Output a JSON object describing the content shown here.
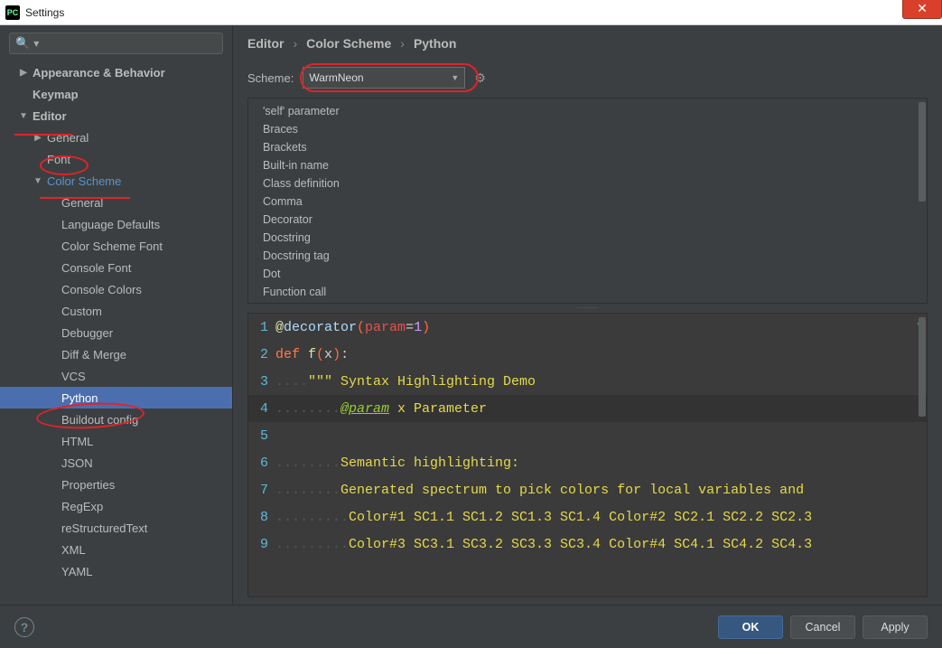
{
  "window": {
    "title": "Settings"
  },
  "search": {
    "placeholder": "Q"
  },
  "sidebar": {
    "items": [
      {
        "label": "Appearance & Behavior",
        "bold": true,
        "caret": "right",
        "cls": ""
      },
      {
        "label": "Keymap",
        "bold": true,
        "caret": "",
        "cls": "nocaret"
      },
      {
        "label": "Editor",
        "bold": true,
        "caret": "down",
        "cls": ""
      },
      {
        "label": "General",
        "bold": false,
        "caret": "right",
        "cls": "ind1"
      },
      {
        "label": "Font",
        "bold": false,
        "caret": "",
        "cls": "ind1 nocaret"
      },
      {
        "label": "Color Scheme",
        "bold": false,
        "caret": "down",
        "cls": "ind1 active"
      },
      {
        "label": "General",
        "bold": false,
        "caret": "",
        "cls": "ind2 nocaret"
      },
      {
        "label": "Language Defaults",
        "bold": false,
        "caret": "",
        "cls": "ind2 nocaret"
      },
      {
        "label": "Color Scheme Font",
        "bold": false,
        "caret": "",
        "cls": "ind2 nocaret"
      },
      {
        "label": "Console Font",
        "bold": false,
        "caret": "",
        "cls": "ind2 nocaret"
      },
      {
        "label": "Console Colors",
        "bold": false,
        "caret": "",
        "cls": "ind2 nocaret"
      },
      {
        "label": "Custom",
        "bold": false,
        "caret": "",
        "cls": "ind2 nocaret"
      },
      {
        "label": "Debugger",
        "bold": false,
        "caret": "",
        "cls": "ind2 nocaret"
      },
      {
        "label": "Diff & Merge",
        "bold": false,
        "caret": "",
        "cls": "ind2 nocaret"
      },
      {
        "label": "VCS",
        "bold": false,
        "caret": "",
        "cls": "ind2 nocaret"
      },
      {
        "label": "Python",
        "bold": false,
        "caret": "",
        "cls": "ind2 nocaret selected"
      },
      {
        "label": "Buildout config",
        "bold": false,
        "caret": "",
        "cls": "ind2 nocaret"
      },
      {
        "label": "HTML",
        "bold": false,
        "caret": "",
        "cls": "ind2 nocaret"
      },
      {
        "label": "JSON",
        "bold": false,
        "caret": "",
        "cls": "ind2 nocaret"
      },
      {
        "label": "Properties",
        "bold": false,
        "caret": "",
        "cls": "ind2 nocaret"
      },
      {
        "label": "RegExp",
        "bold": false,
        "caret": "",
        "cls": "ind2 nocaret"
      },
      {
        "label": "reStructuredText",
        "bold": false,
        "caret": "",
        "cls": "ind2 nocaret"
      },
      {
        "label": "XML",
        "bold": false,
        "caret": "",
        "cls": "ind2 nocaret"
      },
      {
        "label": "YAML",
        "bold": false,
        "caret": "",
        "cls": "ind2 nocaret"
      }
    ]
  },
  "breadcrumb": {
    "a": "Editor",
    "b": "Color Scheme",
    "c": "Python"
  },
  "scheme": {
    "label": "Scheme:",
    "value": "WarmNeon"
  },
  "attrs": [
    "'self' parameter",
    "Braces",
    "Brackets",
    "Built-in name",
    "Class definition",
    "Comma",
    "Decorator",
    "Docstring",
    "Docstring tag",
    "Dot",
    "Function call"
  ],
  "code": {
    "lines": [
      {
        "n": "1",
        "seg": [
          [
            "tk-at",
            "@"
          ],
          [
            "tk-dec",
            "decorator"
          ],
          [
            "tk-paren",
            "("
          ],
          [
            "tk-param",
            "param"
          ],
          [
            "tk-default",
            "="
          ],
          [
            "tk-num",
            "1"
          ],
          [
            "tk-paren",
            ")"
          ]
        ]
      },
      {
        "n": "2",
        "seg": [
          [
            "tk-kw",
            "def "
          ],
          [
            "tk-fn",
            "f"
          ],
          [
            "tk-paren",
            "("
          ],
          [
            "tk-default",
            "x"
          ],
          [
            "tk-paren",
            ")"
          ],
          [
            "tk-default",
            ":"
          ]
        ]
      },
      {
        "n": "3",
        "seg": [
          [
            "tk-dots",
            "...."
          ],
          [
            "tk-str",
            "\"\"\" Syntax Highlighting Demo"
          ]
        ]
      },
      {
        "n": "4",
        "hl": true,
        "seg": [
          [
            "tk-dots",
            "........"
          ],
          [
            "tk-doctag",
            "@param"
          ],
          [
            "tk-str",
            " x Parameter"
          ]
        ]
      },
      {
        "n": "5",
        "seg": []
      },
      {
        "n": "6",
        "seg": [
          [
            "tk-dots",
            "........"
          ],
          [
            "tk-str",
            "Semantic highlighting:"
          ]
        ]
      },
      {
        "n": "7",
        "seg": [
          [
            "tk-dots",
            "........"
          ],
          [
            "tk-str",
            "Generated spectrum to pick colors for local variables and "
          ]
        ]
      },
      {
        "n": "8",
        "seg": [
          [
            "tk-dots",
            "........."
          ],
          [
            "tk-str",
            "Color#1 SC1.1 SC1.2 SC1.3 SC1.4 Color#2 SC2.1 SC2.2 SC2.3"
          ]
        ]
      },
      {
        "n": "9",
        "seg": [
          [
            "tk-dots",
            "........."
          ],
          [
            "tk-str",
            "Color#3 SC3.1 SC3.2 SC3.3 SC3.4 Color#4 SC4.1 SC4.2 SC4.3"
          ]
        ]
      }
    ]
  },
  "buttons": {
    "ok": "OK",
    "cancel": "Cancel",
    "apply": "Apply"
  }
}
